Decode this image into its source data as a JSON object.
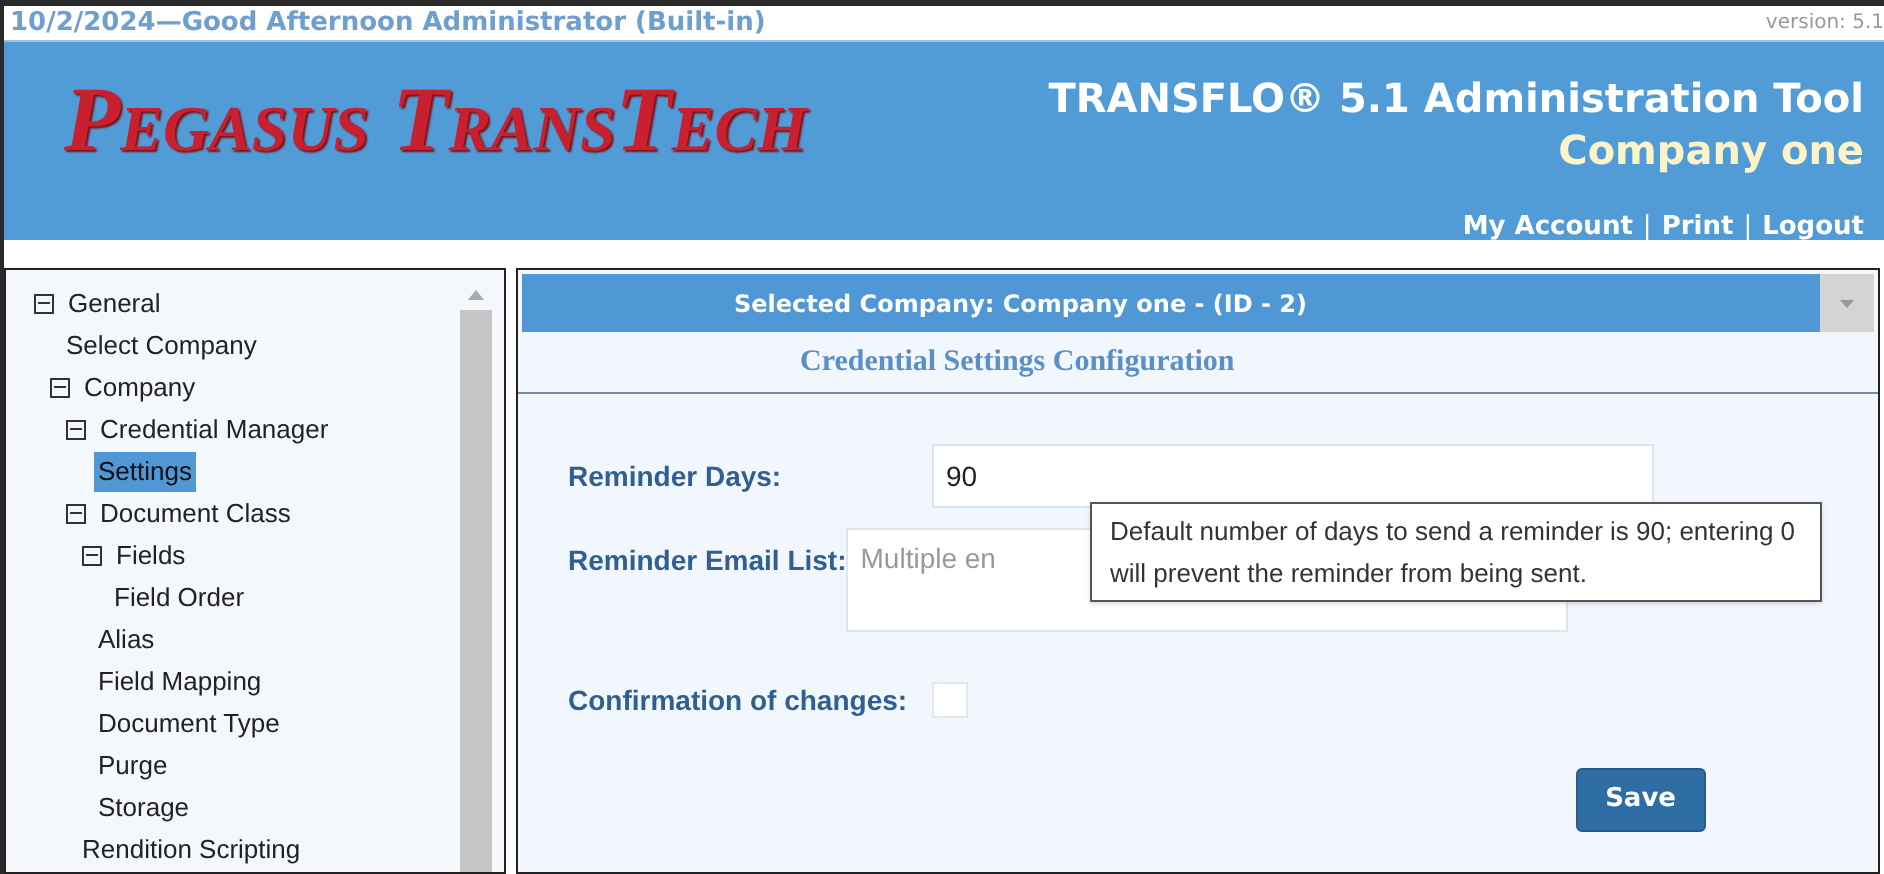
{
  "header": {
    "greeting": "10/2/2024—Good Afternoon Administrator (Built-in)",
    "version": "version: 5.1",
    "logo": "Pegasus TransTech",
    "title": "TRANSFLO® 5.1 Administration Tool",
    "company": "Company one",
    "links": [
      "My Account",
      "Print",
      "Logout"
    ],
    "separators": [
      "|",
      "|"
    ]
  },
  "tree": [
    {
      "label": "General",
      "selected": false,
      "expanded": true,
      "children": [
        {
          "label": "Select Company",
          "selected": false
        },
        {
          "label": "Company",
          "selected": false,
          "expanded": true,
          "children": [
            {
              "label": "Credential Manager",
              "selected": false,
              "expanded": true,
              "children": [
                {
                  "label": "Settings",
                  "selected": true
                }
              ]
            },
            {
              "label": "Document Class",
              "selected": false,
              "expanded": true,
              "children": [
                {
                  "label": "Fields",
                  "selected": false,
                  "expanded": true,
                  "children": [
                    {
                      "label": "Field Order",
                      "selected": false
                    }
                  ]
                },
                {
                  "label": "Alias",
                  "selected": false
                },
                {
                  "label": "Field Mapping",
                  "selected": false
                },
                {
                  "label": "Document Type",
                  "selected": false
                },
                {
                  "label": "Purge",
                  "selected": false
                },
                {
                  "label": "Storage",
                  "selected": false
                }
              ]
            },
            {
              "label": "Rendition Scripting",
              "selected": false
            }
          ]
        }
      ]
    }
  ],
  "company_bar": "Selected Company: Company one - (ID - 2)",
  "section_title": "Credential Settings Configuration",
  "fields": [
    {
      "kind": "text",
      "label": "Reminder Days:",
      "value": "90"
    },
    {
      "kind": "textarea",
      "label": "Reminder Email List:",
      "placeholder": "Multiple en"
    },
    {
      "kind": "checkbox",
      "label": "Confirmation of changes:",
      "checked": false
    }
  ],
  "tooltip": "Default number of days to send a reminder is 90; entering 0 will prevent the reminder from being sent.",
  "save_button": "Save"
}
